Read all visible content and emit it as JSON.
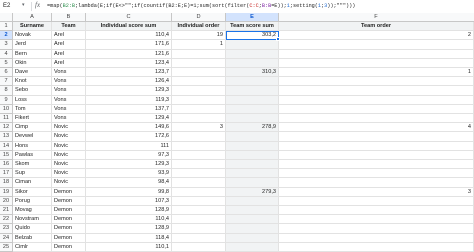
{
  "formula_bar": {
    "cell_ref": "E2",
    "fx": "fx",
    "formula_parts": [
      {
        "t": "=map(",
        "c": ""
      },
      {
        "t": "B2:B",
        "c": "r1"
      },
      {
        "t": ";lambda(E;if(E<>\"\";if(countif(B2:E;E)=1;sum(sort(filter(",
        "c": ""
      },
      {
        "t": "C:C",
        "c": "r2"
      },
      {
        "t": ";",
        "c": ""
      },
      {
        "t": "B:B",
        "c": "r3"
      },
      {
        "t": "=E));",
        "c": ""
      },
      {
        "t": "1",
        "c": "n"
      },
      {
        "t": ";setting(",
        "c": ""
      },
      {
        "t": "1",
        "c": "n"
      },
      {
        "t": ";",
        "c": ""
      },
      {
        "t": "3",
        "c": "n"
      },
      {
        "t": "));\"\"\")))",
        "c": ""
      }
    ]
  },
  "columns": [
    "A",
    "B",
    "C",
    "D",
    "E",
    "F"
  ],
  "rows": [
    {
      "n": "1",
      "a": "Surname",
      "b": "Team",
      "c": "Individual score sum",
      "d": "Individual order",
      "e": "Team score sum",
      "f": "Team order",
      "header": true
    },
    {
      "n": "2",
      "a": "Novak",
      "b": "Arel",
      "c": "110,4",
      "d": "19",
      "e": "303,2",
      "f": "2"
    },
    {
      "n": "3",
      "a": "Jerd",
      "b": "Arel",
      "c": "171,6",
      "d": "1",
      "e": "",
      "f": ""
    },
    {
      "n": "4",
      "a": "Bern",
      "b": "Arel",
      "c": "121,6",
      "d": "",
      "e": "",
      "f": ""
    },
    {
      "n": "5",
      "a": "Okin",
      "b": "Arel",
      "c": "123,4",
      "d": "",
      "e": "",
      "f": ""
    },
    {
      "n": "6",
      "a": "Dave",
      "b": "Vons",
      "c": "123,7",
      "d": "",
      "e": "310,3",
      "f": "1"
    },
    {
      "n": "7",
      "a": "Knot",
      "b": "Vons",
      "c": "126,4",
      "d": "",
      "e": "",
      "f": ""
    },
    {
      "n": "8",
      "a": "Sebo",
      "b": "Vons",
      "c": "129,3",
      "d": "",
      "e": "",
      "f": ""
    },
    {
      "n": "9",
      "a": "Loss",
      "b": "Vons",
      "c": "119,3",
      "d": "",
      "e": "",
      "f": ""
    },
    {
      "n": "10",
      "a": "Tom",
      "b": "Vons",
      "c": "137,7",
      "d": "",
      "e": "",
      "f": ""
    },
    {
      "n": "11",
      "a": "Fikert",
      "b": "Vons",
      "c": "129,4",
      "d": "",
      "e": "",
      "f": ""
    },
    {
      "n": "12",
      "a": "Cimp",
      "b": "Novic",
      "c": "149,6",
      "d": "3",
      "e": "278,9",
      "f": "4"
    },
    {
      "n": "13",
      "a": "Devwel",
      "b": "Novic",
      "c": "172,6",
      "d": "",
      "e": "",
      "f": ""
    },
    {
      "n": "14",
      "a": "Hons",
      "b": "Novic",
      "c": "111",
      "d": "",
      "e": "",
      "f": ""
    },
    {
      "n": "15",
      "a": "Pawlas",
      "b": "Novic",
      "c": "97,3",
      "d": "",
      "e": "",
      "f": ""
    },
    {
      "n": "16",
      "a": "Skom",
      "b": "Novic",
      "c": "129,3",
      "d": "",
      "e": "",
      "f": ""
    },
    {
      "n": "17",
      "a": "Sup",
      "b": "Novic",
      "c": "93,9",
      "d": "",
      "e": "",
      "f": ""
    },
    {
      "n": "18",
      "a": "Ciman",
      "b": "Novic",
      "c": "98,4",
      "d": "",
      "e": "",
      "f": ""
    },
    {
      "n": "19",
      "a": "Sikor",
      "b": "Demon",
      "c": "99,8",
      "d": "",
      "e": "279,3",
      "f": "3"
    },
    {
      "n": "20",
      "a": "Porug",
      "b": "Demon",
      "c": "107,3",
      "d": "",
      "e": "",
      "f": ""
    },
    {
      "n": "21",
      "a": "Movag",
      "b": "Demon",
      "c": "128,9",
      "d": "",
      "e": "",
      "f": ""
    },
    {
      "n": "22",
      "a": "Novstram",
      "b": "Demon",
      "c": "110,4",
      "d": "",
      "e": "",
      "f": ""
    },
    {
      "n": "23",
      "a": "Quido",
      "b": "Demon",
      "c": "128,9",
      "d": "",
      "e": "",
      "f": ""
    },
    {
      "n": "24",
      "a": "Belzab",
      "b": "Demon",
      "c": "118,4",
      "d": "",
      "e": "",
      "f": ""
    },
    {
      "n": "25",
      "a": "Cimlr",
      "b": "Demon",
      "c": "110,1",
      "d": "",
      "e": "",
      "f": ""
    }
  ]
}
